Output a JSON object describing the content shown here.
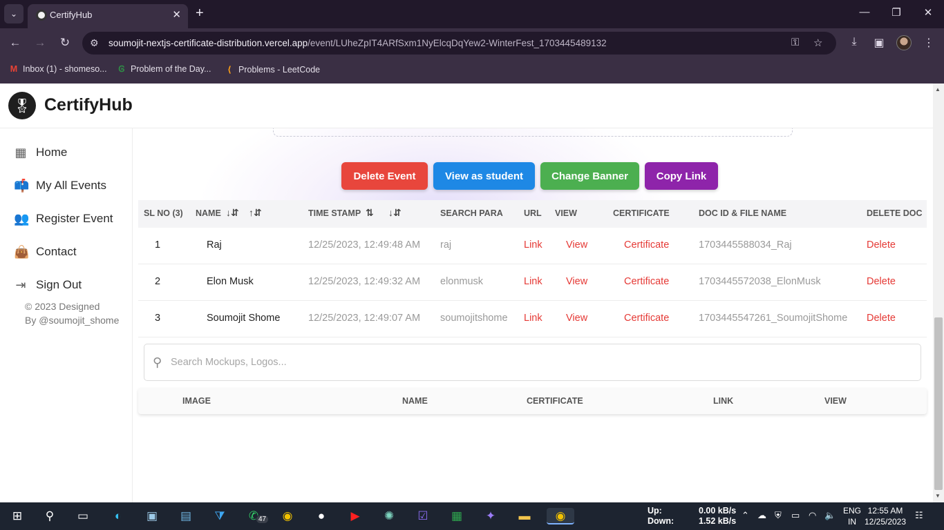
{
  "browser": {
    "tab_title": "CertifyHub",
    "url_host": "soumojit-nextjs-certificate-distribution.vercel.app",
    "url_path": "/event/LUheZpIT4ARfSxm1NyElcqDqYew2-WinterFest_1703445489132",
    "bookmarks": [
      {
        "label": "Inbox (1) - shomeso..."
      },
      {
        "label": "Problem of the Day..."
      },
      {
        "label": "Problems - LeetCode"
      }
    ]
  },
  "app": {
    "brand": "CertifyHub"
  },
  "sidebar": {
    "items": [
      {
        "label": "Home",
        "icon": "grid-icon"
      },
      {
        "label": "My All Events",
        "icon": "mailbox-icon"
      },
      {
        "label": "Register Event",
        "icon": "users-icon"
      },
      {
        "label": "Contact",
        "icon": "bag-icon"
      },
      {
        "label": "Sign Out",
        "icon": "sign-out-icon"
      }
    ],
    "footer_line1": "© 2023 Designed",
    "footer_line2": "By @soumojit_shome"
  },
  "actions": {
    "delete_event": "Delete Event",
    "view_as_student": "View as student",
    "change_banner": "Change Banner",
    "copy_link": "Copy Link",
    "colors": {
      "delete": "#e8463c",
      "view": "#1e88e5",
      "banner": "#4caf50",
      "copy": "#8e24aa"
    }
  },
  "table": {
    "headers": {
      "sl": "SL NO (3)",
      "name": "NAME",
      "time": "TIME STAMP",
      "search": "SEARCH PARA",
      "url": "URL",
      "view": "VIEW",
      "certificate": "CERTIFICATE",
      "docid": "DOC ID & FILE NAME",
      "delete": "DELETE DOC"
    },
    "rows": [
      {
        "sl": "1",
        "name": "Raj",
        "time": "12/25/2023, 12:49:48 AM",
        "search": "raj",
        "url": "Link",
        "view": "View",
        "certificate": "Certificate",
        "docid": "1703445588034_Raj",
        "delete": "Delete"
      },
      {
        "sl": "2",
        "name": "Elon Musk",
        "time": "12/25/2023, 12:49:32 AM",
        "search": "elonmusk",
        "url": "Link",
        "view": "View",
        "certificate": "Certificate",
        "docid": "1703445572038_ElonMusk",
        "delete": "Delete"
      },
      {
        "sl": "3",
        "name": "Soumojit Shome",
        "time": "12/25/2023, 12:49:07 AM",
        "search": "soumojitshome",
        "url": "Link",
        "view": "View",
        "certificate": "Certificate",
        "docid": "1703445547261_SoumojitShome",
        "delete": "Delete"
      }
    ]
  },
  "search": {
    "placeholder": "Search Mockups, Logos...",
    "value": ""
  },
  "table2": {
    "headers": {
      "image": "IMAGE",
      "name": "NAME",
      "certificate": "CERTIFICATE",
      "link": "LINK",
      "view": "VIEW"
    }
  },
  "taskbar": {
    "whatsapp_badge": "47",
    "net_up_label": "Up:",
    "net_down_label": "Down:",
    "net_up": "0.00 kB/s",
    "net_down": "1.52 kB/s",
    "lang1": "ENG",
    "lang2": "IN",
    "time": "12:55 AM",
    "date": "12/25/2023"
  }
}
